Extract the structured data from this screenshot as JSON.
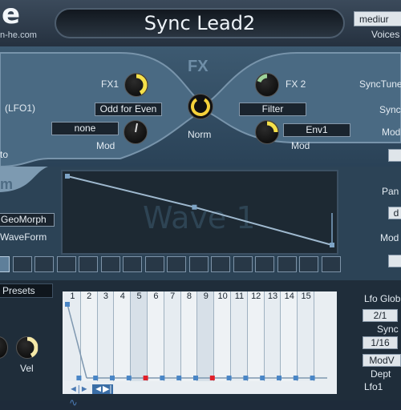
{
  "header": {
    "logo_text": "e",
    "logo_url": "n-he.com",
    "preset_name": "Sync Lead2",
    "voices_value": "mediur",
    "voices_label": "Voices"
  },
  "fx": {
    "title": "FX",
    "fx1_label": "FX1",
    "fx1_mode": "Odd for Even",
    "fx2_label": "FX 2",
    "fx2_mode": "Filter",
    "norm_label": "Norm",
    "lfo_label": "(LFO1)",
    "mod_left_value": "none",
    "mod_left_label": "Mod",
    "mod_right_value": "Env1",
    "mod_right_label": "Mod",
    "left_partial": "to",
    "right_synctune": "SyncTune",
    "right_sync": "Sync",
    "right_mod": "Mod"
  },
  "waveform": {
    "section_partial": "m",
    "geomorph_label": "GeoMorph",
    "waveform_label": "WaveForm",
    "wave_title": "Wave 1",
    "right_pan": "Pan",
    "right_d": "d",
    "right_mod": "Mod",
    "points": [
      [
        0,
        1
      ],
      [
        0.48,
        0.55
      ],
      [
        1,
        0
      ]
    ],
    "steps_count": 15
  },
  "lfo": {
    "presets_label": "Presets",
    "vel_label": "Vel",
    "columns": [
      "1",
      "2",
      "3",
      "4",
      "5",
      "6",
      "7",
      "8",
      "9",
      "10",
      "11",
      "12",
      "13",
      "14",
      "15"
    ],
    "highlighted_columns": [
      5,
      9
    ],
    "right_title": "Lfo Glob",
    "rate_value": "2/1",
    "sync_label": "Sync",
    "division_value": "1/16",
    "modv_value": "ModV",
    "depth_label": "Dept",
    "lfo1_label": "Lfo1"
  }
}
